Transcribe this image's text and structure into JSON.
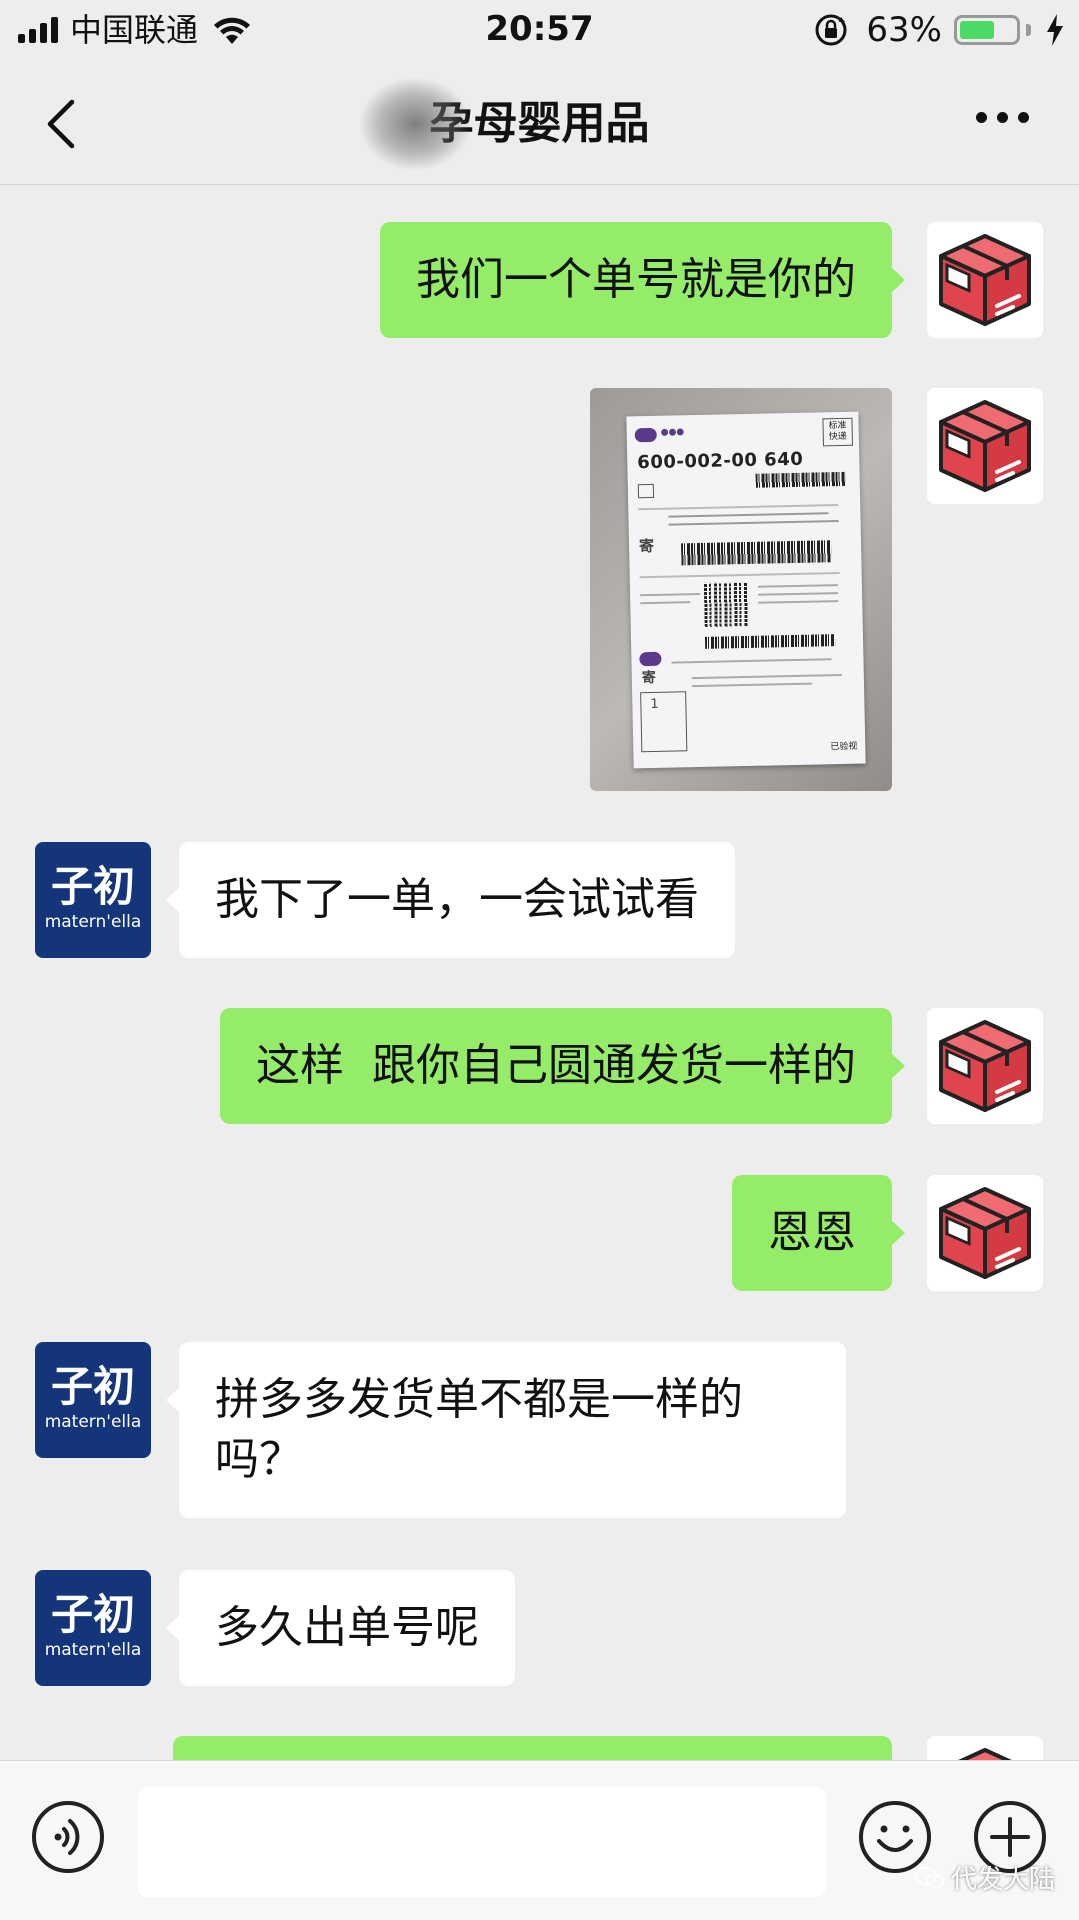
{
  "status_bar": {
    "carrier": "中国联通",
    "time": "20:57",
    "battery_percent_text": "63%",
    "battery_level": 0.63
  },
  "header": {
    "title": "孕母婴用品"
  },
  "avatars": {
    "brand_cn": "子初",
    "brand_en": "matern'ella"
  },
  "messages": [
    {
      "side": "out",
      "type": "text",
      "text": "我们一个单号就是你的"
    },
    {
      "side": "out",
      "type": "image",
      "image_label": {
        "courier_type": "标准快递",
        "tracking_code": "600-002-00 640",
        "send_mark": "寄",
        "count": "1",
        "signed": "已验视"
      }
    },
    {
      "side": "in",
      "type": "text",
      "text": "我下了一单，一会试试看"
    },
    {
      "side": "out",
      "type": "text",
      "text": "这样  跟你自己圆通发货一样的"
    },
    {
      "side": "out",
      "type": "text",
      "text": "恩恩"
    },
    {
      "side": "in",
      "type": "text",
      "text": "拼多多发货单不都是一样的吗？"
    },
    {
      "side": "in",
      "type": "text",
      "text": "多久出单号呢"
    }
  ],
  "input_bar": {
    "placeholder": "",
    "watermark": "代发大陆"
  },
  "colors": {
    "outgoing_bubble": "#95ec69",
    "incoming_bubble": "#ffffff",
    "background": "#ededed",
    "brand_avatar": "#14357a",
    "box_avatar": "#e0454d"
  },
  "icons": [
    "signal-icon",
    "wifi-icon",
    "rotation-lock-icon",
    "battery-icon",
    "charging-icon",
    "back-arrow-icon",
    "more-icon",
    "package-box-icon",
    "voice-icon",
    "emoji-icon",
    "plus-icon"
  ]
}
